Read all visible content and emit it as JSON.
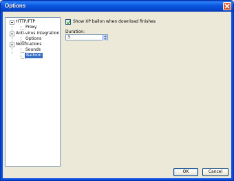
{
  "window": {
    "title": "Options"
  },
  "tree": {
    "items": [
      {
        "label": "HTTP/FTP"
      },
      {
        "label": "Proxy"
      },
      {
        "label": "Anti-virus integration"
      },
      {
        "label": "Options"
      },
      {
        "label": "Notifications"
      },
      {
        "label": "Sounds"
      },
      {
        "label": "Balloon",
        "selected": true
      }
    ]
  },
  "settings": {
    "show_balloon": {
      "label": "Show XP ballon when download finishes",
      "checked": true
    },
    "duration": {
      "label": "Duration:",
      "value": "3"
    }
  },
  "buttons": {
    "ok": "OK",
    "cancel": "Cancel"
  },
  "colors": {
    "titlebar": "#0a58e0",
    "selection": "#316ac5",
    "close": "#c8401e"
  }
}
